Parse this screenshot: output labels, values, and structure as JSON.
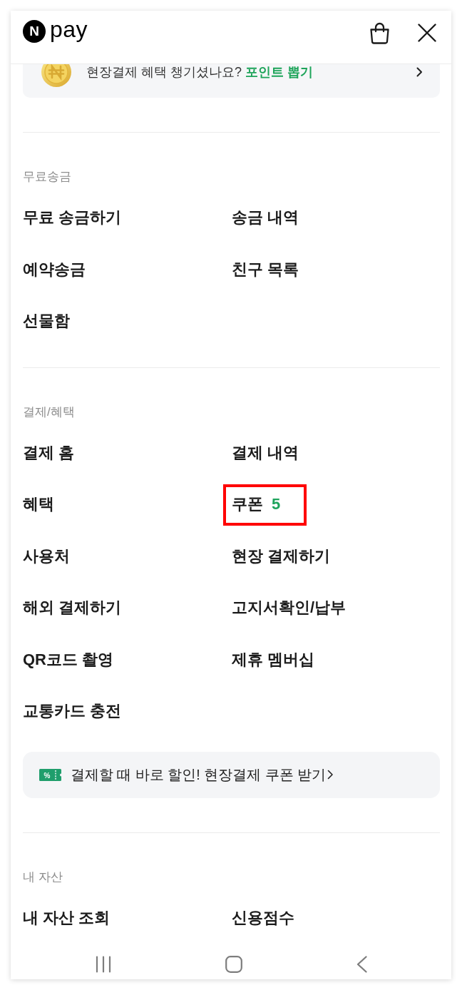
{
  "header": {
    "logo": {
      "mark": "N",
      "word": "pay"
    }
  },
  "banner": {
    "text": "현장결제 혜택 챙기셨나요?",
    "link": "포인트 뽑기"
  },
  "sections": [
    {
      "title": "무료송금",
      "items": [
        {
          "label": "무료 송금하기",
          "highlighted": false
        },
        {
          "label": "송금 내역",
          "highlighted": false
        },
        {
          "label": "예약송금",
          "highlighted": false
        },
        {
          "label": "친구 목록",
          "highlighted": false
        },
        {
          "label": "선물함",
          "highlighted": false
        }
      ]
    },
    {
      "title": "결제/혜택",
      "items": [
        {
          "label": "결제 홈",
          "highlighted": false
        },
        {
          "label": "결제 내역",
          "highlighted": false
        },
        {
          "label": "혜택",
          "highlighted": false
        },
        {
          "label": "쿠폰",
          "count": "5",
          "highlighted": true
        },
        {
          "label": "사용처",
          "highlighted": false
        },
        {
          "label": "현장 결제하기",
          "highlighted": false
        },
        {
          "label": "해외 결제하기",
          "highlighted": false
        },
        {
          "label": "고지서확인/납부",
          "highlighted": false
        },
        {
          "label": "QR코드 촬영",
          "highlighted": false
        },
        {
          "label": "제휴 멤버십",
          "highlighted": false
        },
        {
          "label": "교통카드 충전",
          "highlighted": false
        }
      ],
      "promo": {
        "icon_text": "%",
        "text": "결제할 때 바로 할인! 현장결제 쿠폰 받기"
      }
    },
    {
      "title": "내 자산",
      "items": [
        {
          "label": "내 자산 조회",
          "highlighted": false
        },
        {
          "label": "신용점수",
          "highlighted": false
        }
      ]
    }
  ]
}
